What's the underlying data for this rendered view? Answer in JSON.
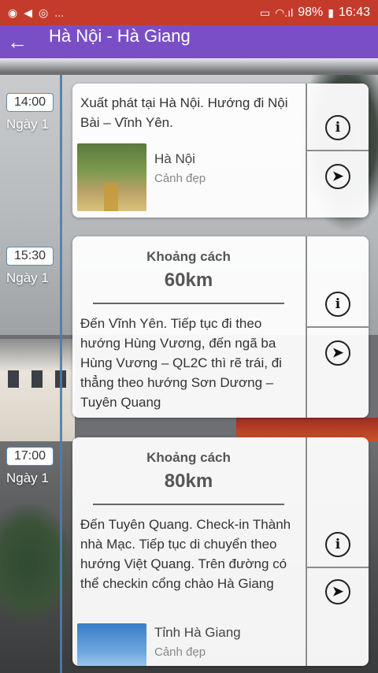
{
  "status_bar": {
    "left_icons": [
      "notification-dot-icon",
      "send-icon",
      "sync-icon",
      "more-dots-icon"
    ],
    "more_text": "...",
    "battery": "98%",
    "time": "16:43"
  },
  "app_bar": {
    "title": "Hà Nội - Hà Giang",
    "back_icon": "arrow-left-icon"
  },
  "timeline": [
    {
      "time": "14:00",
      "day": "Ngày 1",
      "description": "Xuất phát tại Hà Nội. Hướng đi Nội Bài – Vĩnh Yên.",
      "place": {
        "name": "Hà Nội",
        "sub": "Cảnh đẹp"
      }
    },
    {
      "time": "15:30",
      "day": "Ngày 1",
      "distance_label": "Khoảng cách",
      "distance_value": "60km",
      "description": "Đến Vĩnh Yên. Tiếp tục đi theo hướng Hùng Vương, đến ngã ba Hùng Vương – QL2C thì rẽ trái, đi thẳng theo hướng Sơn Dương – Tuyên Quang"
    },
    {
      "time": "17:00",
      "day": "Ngày 1",
      "distance_label": "Khoảng cách",
      "distance_value": "80km",
      "description": "Đến Tuyên Quang. Check-in Thành nhà Mạc. Tiếp tục di chuyển theo hướng Việt Quang. Trên đường có thể checkin cổng chào Hà Giang",
      "place": {
        "name": "Tỉnh Hà Giang",
        "sub": "Cảnh đẹp"
      }
    }
  ],
  "card_buttons": {
    "info_glyph": "i",
    "navigate_glyph": "➤"
  }
}
